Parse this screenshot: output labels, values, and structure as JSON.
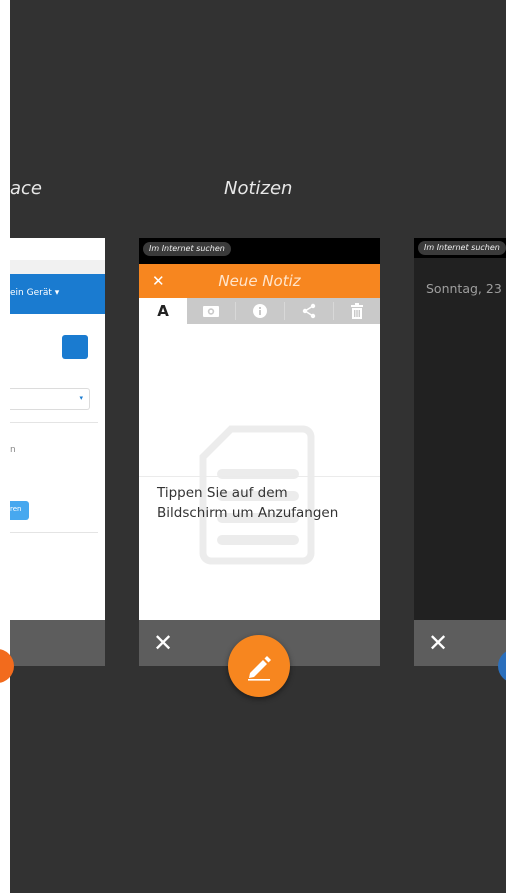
{
  "cards": [
    {
      "id": "left",
      "title": "ace",
      "device_label": "ein Gerät",
      "dropdown_arrow": "▾",
      "button_text": "ren",
      "small_text": "n"
    },
    {
      "id": "notes",
      "title": "Notizen",
      "search_chip": "Im Internet suchen",
      "header_title": "Neue Notiz",
      "header_close": "✕",
      "toolbar_text_tool": "A",
      "empty_hint_line1": "Tippen Sie auf dem",
      "empty_hint_line2": "Bildschirm um Anzufangen",
      "footer_close": "✕"
    },
    {
      "id": "right",
      "search_chip": "Im Internet suchen",
      "date_text": "Sonntag, 23",
      "footer_close": "✕"
    }
  ],
  "colors": {
    "background": "#323232",
    "accent_orange": "#f7861f",
    "blue_header": "#1a7bd0",
    "footer_gray": "#5d5d5d"
  },
  "icons": {
    "fab": "pencil-icon",
    "toolbar": [
      "text-format-icon",
      "camera-icon",
      "info-icon",
      "share-icon",
      "trash-icon"
    ]
  }
}
